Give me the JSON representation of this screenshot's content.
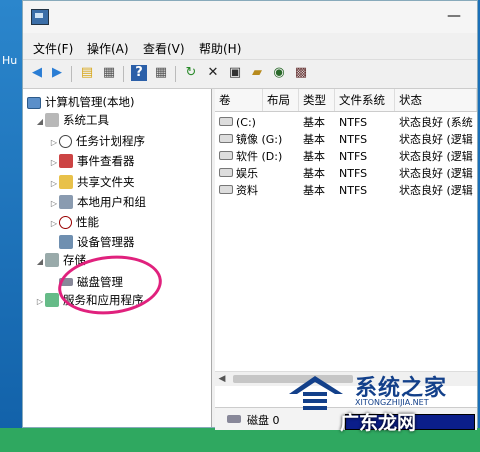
{
  "desktop": {
    "edge_label": "Hu"
  },
  "window": {
    "min_glyph": "—"
  },
  "menu": [
    "文件(F)",
    "操作(A)",
    "查看(V)",
    "帮助(H)"
  ],
  "toolbar": [
    "back",
    "forward",
    "up-folder",
    "show-hide-tree",
    "help",
    "properties-view",
    "refresh",
    "delete",
    "properties",
    "open",
    "zoom",
    "settings"
  ],
  "tree": {
    "root": "计算机管理(本地)",
    "system_tools": "系统工具",
    "task_scheduler": "任务计划程序",
    "event_viewer": "事件查看器",
    "shared_folders": "共享文件夹",
    "local_users": "本地用户和组",
    "performance": "性能",
    "device_manager": "设备管理器",
    "storage": "存储",
    "disk_management": "磁盘管理",
    "services": "服务和应用程序"
  },
  "columns": [
    "卷",
    "布局",
    "类型",
    "文件系统",
    "状态"
  ],
  "volumes": [
    {
      "name": "(C:)",
      "layout": "",
      "type": "基本",
      "fs": "NTFS",
      "status": "状态良好 (系统"
    },
    {
      "name": "镜像 (G:)",
      "layout": "",
      "type": "基本",
      "fs": "NTFS",
      "status": "状态良好 (逻辑"
    },
    {
      "name": "软件 (D:)",
      "layout": "",
      "type": "基本",
      "fs": "NTFS",
      "status": "状态良好 (逻辑"
    },
    {
      "name": "娱乐",
      "layout": "",
      "type": "基本",
      "fs": "NTFS",
      "status": "状态良好 (逻辑"
    },
    {
      "name": "资料",
      "layout": "",
      "type": "基本",
      "fs": "NTFS",
      "status": "状态良好 (逻辑"
    }
  ],
  "disk": {
    "label": "磁盘 0"
  },
  "watermark": {
    "main": "系统之家",
    "url": "XITONGZHIJIA.NET",
    "site": "广东龙网"
  },
  "colors": {
    "accent": "#e0217d",
    "disk_bar": "#0b1e8a",
    "desktop": "#1a6fb8",
    "footer": "#2fa860"
  }
}
